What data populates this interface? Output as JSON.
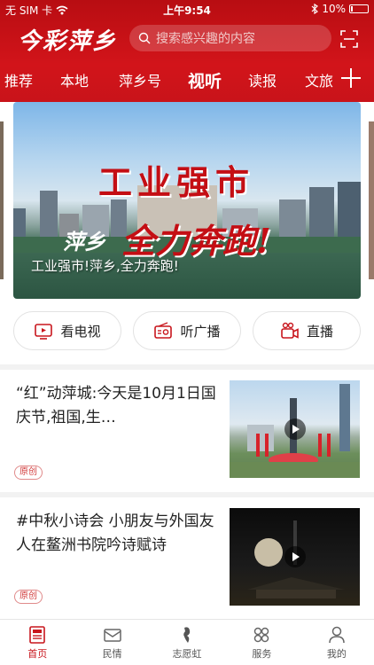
{
  "status_bar": {
    "carrier": "无 SIM 卡",
    "time": "上午9:54",
    "battery": "10%"
  },
  "header": {
    "logo": "今彩萍乡",
    "search_placeholder": "搜索感兴趣的内容"
  },
  "tabs": [
    "推荐",
    "本地",
    "萍乡号",
    "视听",
    "读报",
    "文旅"
  ],
  "active_tab": "视听",
  "banner": {
    "headline_line1": "工业强市",
    "headline_line2_a": "萍乡",
    "headline_line2_b": "全力奔跑!",
    "caption": "工业强市!萍乡,全力奔跑!"
  },
  "quick_buttons": [
    {
      "label": "看电视",
      "icon": "tv-icon"
    },
    {
      "label": "听广播",
      "icon": "radio-icon"
    },
    {
      "label": "直播",
      "icon": "live-camera-icon"
    }
  ],
  "news": [
    {
      "title": "“红”动萍城:今天是10月1日国庆节,祖国,生…",
      "badge": "原创",
      "thumb_icon": "play-icon"
    },
    {
      "title": "#中秋小诗会 小朋友与外国友人在鳌洲书院吟诗赋诗",
      "badge": "原创",
      "thumb_icon": "play-icon"
    }
  ],
  "bottom_nav": [
    {
      "label": "首页",
      "icon": "home-news-icon"
    },
    {
      "label": "民情",
      "icon": "mail-icon"
    },
    {
      "label": "志愿虹",
      "icon": "volunteer-icon"
    },
    {
      "label": "服务",
      "icon": "grid-icon"
    },
    {
      "label": "我的",
      "icon": "user-icon"
    }
  ],
  "colors": {
    "brand_red": "#c8161d",
    "badge_red": "#d23c3c"
  }
}
